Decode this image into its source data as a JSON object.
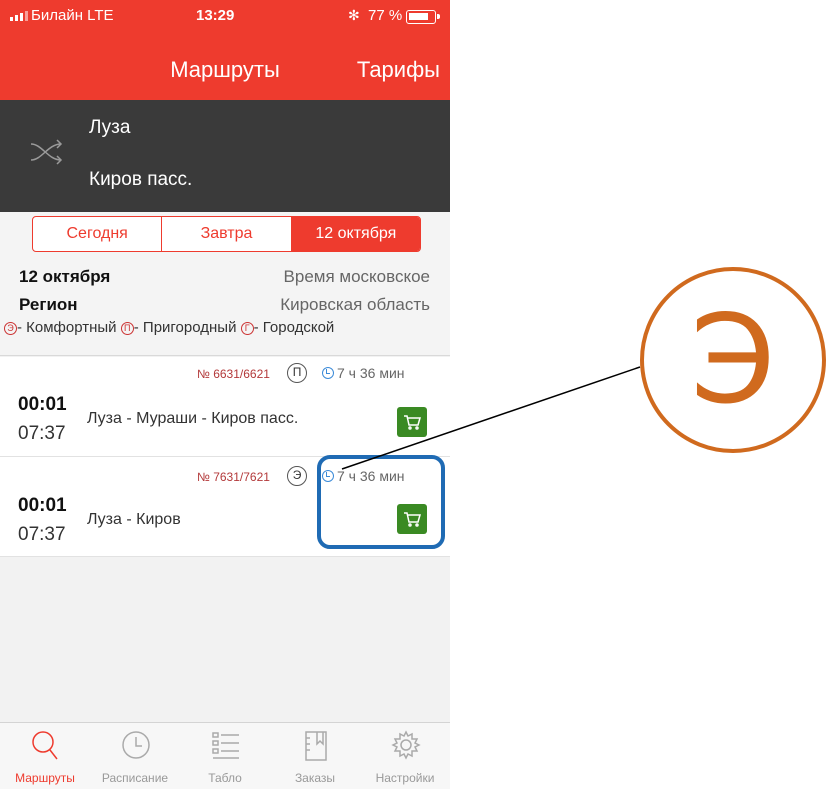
{
  "status_bar": {
    "carrier": "Билайн  LTE",
    "time": "13:29",
    "bluetooth": "✻",
    "battery": "77 %"
  },
  "nav": {
    "title": "Маршруты",
    "tariffs": "Тарифы"
  },
  "route": {
    "from": "Луза",
    "to": "Киров пасс."
  },
  "day_tabs": [
    "Сегодня",
    "Завтра",
    "12 октября"
  ],
  "selected_day": "12 октября",
  "info": {
    "date_label": "12 октября",
    "time_note": "Время московское",
    "region_label": "Регион",
    "region_value": "Кировская область"
  },
  "legend": [
    {
      "code": "Э",
      "label": "- Комфортный"
    },
    {
      "code": "П",
      "label": "- Пригородный"
    },
    {
      "code": "Г",
      "label": "- Городской"
    }
  ],
  "trains": [
    {
      "number": "№ 6631/6621",
      "category": "П",
      "duration": "7 ч 36 мин",
      "departure": "00:01",
      "arrival": "07:37",
      "route": "Луза - Мураши - Киров пасс."
    },
    {
      "number": "№ 7631/7621",
      "category": "Э",
      "duration": "7 ч 36 мин",
      "departure": "00:01",
      "arrival": "07:37",
      "route": "Луза - Киров"
    }
  ],
  "tabs": [
    {
      "label": "Маршруты",
      "icon": "search-icon",
      "active": true
    },
    {
      "label": "Расписание",
      "icon": "clock-icon",
      "active": false
    },
    {
      "label": "Табло",
      "icon": "board-icon",
      "active": false
    },
    {
      "label": "Заказы",
      "icon": "orders-icon",
      "active": false
    },
    {
      "label": "Настройки",
      "icon": "gear-icon",
      "active": false
    }
  ],
  "annotation": {
    "letter": "Э"
  },
  "colors": {
    "brand_red": "#ee3b2e",
    "header_dark": "#3a3a3a",
    "cart_green": "#3a8a23",
    "annotation_orange": "#d06a1e",
    "annotation_blue": "#1f6bb4"
  }
}
